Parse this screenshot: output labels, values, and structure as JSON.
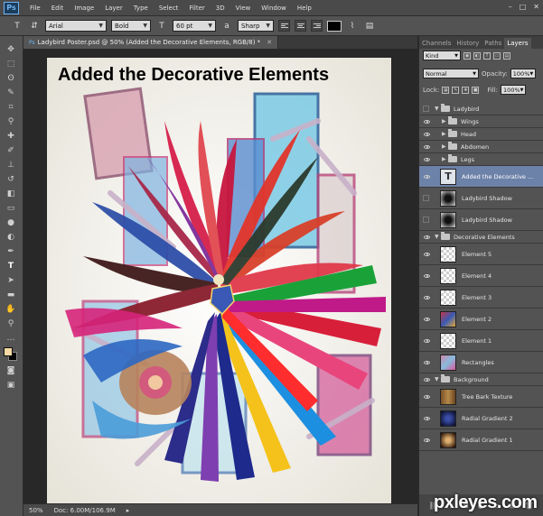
{
  "app": {
    "logo": "Ps",
    "menu": [
      "File",
      "Edit",
      "Image",
      "Layer",
      "Type",
      "Select",
      "Filter",
      "3D",
      "View",
      "Window",
      "Help"
    ],
    "window_controls": [
      "–",
      "□",
      "✕"
    ]
  },
  "options": {
    "font_family": "Arial",
    "font_style": "Bold",
    "font_size": "60 pt",
    "antialias": "Sharp",
    "text_color": "#000000"
  },
  "document": {
    "tab_title": "Ladybird Poster.psd @ 50% (Added the Decorative Elements, RGB/8) *",
    "canvas_text": "Added the Decorative Elements"
  },
  "status": {
    "zoom": "50%",
    "doc_info": "Doc: 6.00M/106.9M"
  },
  "colors": {
    "foreground": "#f4d9a3",
    "background": "#000000",
    "selection": "#6d82a8"
  },
  "panel": {
    "tabs": [
      "Channels",
      "History",
      "Paths",
      "Layers"
    ],
    "filter_kind": "Kind",
    "blend_mode": "Normal",
    "opacity_label": "Opacity:",
    "opacity_value": "100%",
    "lock_label": "Lock:",
    "fill_label": "Fill:",
    "fill_value": "100%",
    "layers": [
      {
        "name": "Ladybird",
        "kind": "group",
        "indent": 0,
        "open": true,
        "visible": false
      },
      {
        "name": "Wings",
        "kind": "group",
        "indent": 1,
        "open": false,
        "visible": true
      },
      {
        "name": "Head",
        "kind": "group",
        "indent": 1,
        "open": false,
        "visible": true
      },
      {
        "name": "Abdomen",
        "kind": "group",
        "indent": 1,
        "open": false,
        "visible": true
      },
      {
        "name": "Legs",
        "kind": "group",
        "indent": 1,
        "open": false,
        "visible": true
      },
      {
        "name": "Added the Decorative ...",
        "kind": "text",
        "indent": 0,
        "visible": true,
        "selected": true
      },
      {
        "name": "Ladybird  Shadow",
        "kind": "pixel",
        "indent": 0,
        "visible": false,
        "thumb": "shadow"
      },
      {
        "name": "Ladybird  Shadow",
        "kind": "pixel",
        "indent": 0,
        "visible": false,
        "thumb": "shadow"
      },
      {
        "name": "Decorative Elements",
        "kind": "group",
        "indent": 0,
        "open": true,
        "visible": true
      },
      {
        "name": "Element 5",
        "kind": "pixel",
        "indent": 0,
        "visible": true,
        "thumb": "element"
      },
      {
        "name": "Element 4",
        "kind": "pixel",
        "indent": 0,
        "visible": true,
        "thumb": "element"
      },
      {
        "name": "Element 3",
        "kind": "pixel",
        "indent": 0,
        "visible": true,
        "thumb": "element"
      },
      {
        "name": "Element 2",
        "kind": "pixel",
        "indent": 0,
        "visible": true,
        "thumb": "element2"
      },
      {
        "name": "Element 1",
        "kind": "pixel",
        "indent": 0,
        "visible": true,
        "thumb": "element"
      },
      {
        "name": "Rectangles",
        "kind": "pixel",
        "indent": 0,
        "visible": true,
        "thumb": "rect"
      },
      {
        "name": "Background",
        "kind": "group",
        "indent": 0,
        "open": true,
        "visible": true
      },
      {
        "name": "Tree Bark Texture",
        "kind": "pixel",
        "indent": 0,
        "visible": true,
        "thumb": "bark"
      },
      {
        "name": "Radial Gradient 2",
        "kind": "pixel",
        "indent": 0,
        "visible": true,
        "thumb": "grad2"
      },
      {
        "name": "Radial Gradient 1",
        "kind": "pixel",
        "indent": 0,
        "visible": true,
        "thumb": "grad1"
      }
    ]
  },
  "watermark": "pxleyes.com"
}
